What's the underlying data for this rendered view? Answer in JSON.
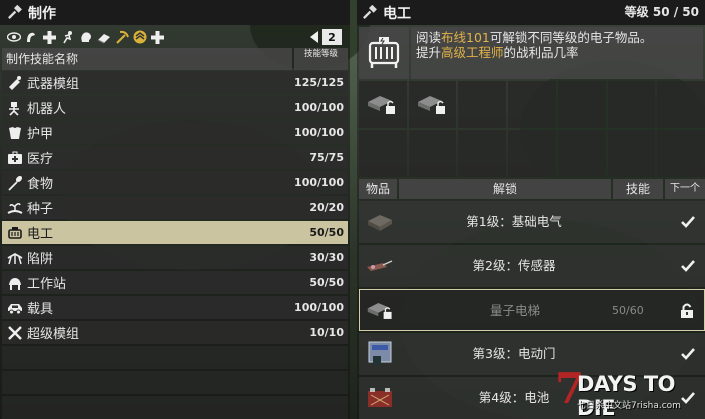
{
  "left_panel": {
    "title": "制作",
    "page_number": "2",
    "col_name": "制作技能名称",
    "col_level": "技能等级",
    "skills": [
      {
        "name": "武器模组",
        "value": "125/125",
        "icon": "weapon-mod-icon"
      },
      {
        "name": "机器人",
        "value": "100/100",
        "icon": "robot-icon"
      },
      {
        "name": "护甲",
        "value": "100/100",
        "icon": "armor-icon"
      },
      {
        "name": "医疗",
        "value": "75/75",
        "icon": "medical-icon"
      },
      {
        "name": "食物",
        "value": "100/100",
        "icon": "food-icon"
      },
      {
        "name": "种子",
        "value": "20/20",
        "icon": "seed-icon"
      },
      {
        "name": "电工",
        "value": "50/50",
        "icon": "electrician-icon"
      },
      {
        "name": "陷阱",
        "value": "30/30",
        "icon": "trap-icon"
      },
      {
        "name": "工作站",
        "value": "50/50",
        "icon": "workstation-icon"
      },
      {
        "name": "载具",
        "value": "100/100",
        "icon": "vehicle-icon"
      },
      {
        "name": "超级模组",
        "value": "10/10",
        "icon": "super-mod-icon"
      }
    ]
  },
  "right_panel": {
    "title": "电工",
    "level": "等级 50 / 50",
    "desc": {
      "p1": "阅读",
      "h1": "布线101",
      "p2": "可解锁不同等级的电子物品。",
      "p3": "提升",
      "h2": "高级工程师",
      "p4": "的战利品几率"
    },
    "table_headers": {
      "item": "物品",
      "unlock": "解锁",
      "skill": "技能",
      "next": "下一个"
    },
    "recipes": [
      {
        "name": "第1级：基础电气",
        "progress": "",
        "status": "check"
      },
      {
        "name": "第2级：传感器",
        "progress": "",
        "status": "check"
      },
      {
        "name": "量子电梯",
        "progress": "50/60",
        "status": "lock"
      },
      {
        "name": "第3级：电动门",
        "progress": "",
        "status": "check"
      },
      {
        "name": "第4级：电池",
        "progress": "",
        "status": "check"
      }
    ]
  },
  "watermark": {
    "seven": "7",
    "title": "DAYS TO DIE",
    "sub": "七日杀中文站7risha.com"
  },
  "colors": {
    "selected_row": "#d4cca8",
    "highlight": "#e0b24a",
    "panel_header": "#1b1b1b"
  }
}
